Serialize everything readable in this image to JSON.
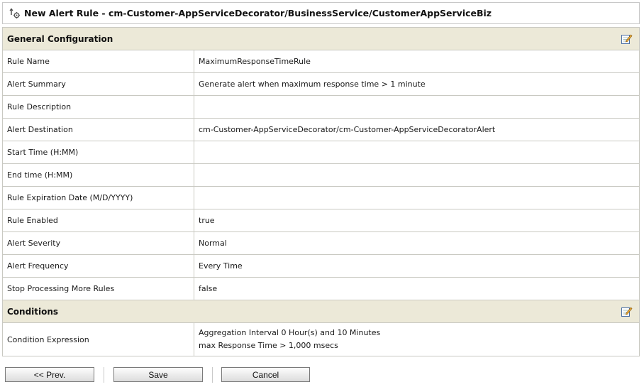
{
  "title": "New Alert Rule - cm-Customer-AppServiceDecorator/BusinessService/CustomerAppServiceBiz",
  "sections": {
    "general": {
      "label": "General Configuration",
      "rows": [
        {
          "label": "Rule Name",
          "value": "MaximumResponseTimeRule"
        },
        {
          "label": "Alert Summary",
          "value": "Generate alert when maximum response time > 1 minute"
        },
        {
          "label": "Rule Description",
          "value": ""
        },
        {
          "label": "Alert Destination",
          "value": "cm-Customer-AppServiceDecorator/cm-Customer-AppServiceDecoratorAlert"
        },
        {
          "label": "Start Time (H:MM)",
          "value": ""
        },
        {
          "label": "End time (H:MM)",
          "value": ""
        },
        {
          "label": "Rule Expiration Date (M/D/YYYY)",
          "value": ""
        },
        {
          "label": "Rule Enabled",
          "value": "true"
        },
        {
          "label": "Alert Severity",
          "value": "Normal"
        },
        {
          "label": "Alert Frequency",
          "value": "Every Time"
        },
        {
          "label": "Stop Processing More Rules",
          "value": "false"
        }
      ]
    },
    "conditions": {
      "label": "Conditions",
      "row": {
        "label": "Condition Expression",
        "lines": [
          "Aggregation Interval 0 Hour(s) and 10 Minutes",
          "max Response Time > 1,000 msecs"
        ]
      }
    }
  },
  "buttons": {
    "prev": "<< Prev.",
    "save": "Save",
    "cancel": "Cancel"
  },
  "icons": {
    "title": "alert-rule-icon",
    "edit": "edit-icon"
  },
  "colors": {
    "section_bg": "#ece9d8",
    "border": "#c9c9c2"
  }
}
